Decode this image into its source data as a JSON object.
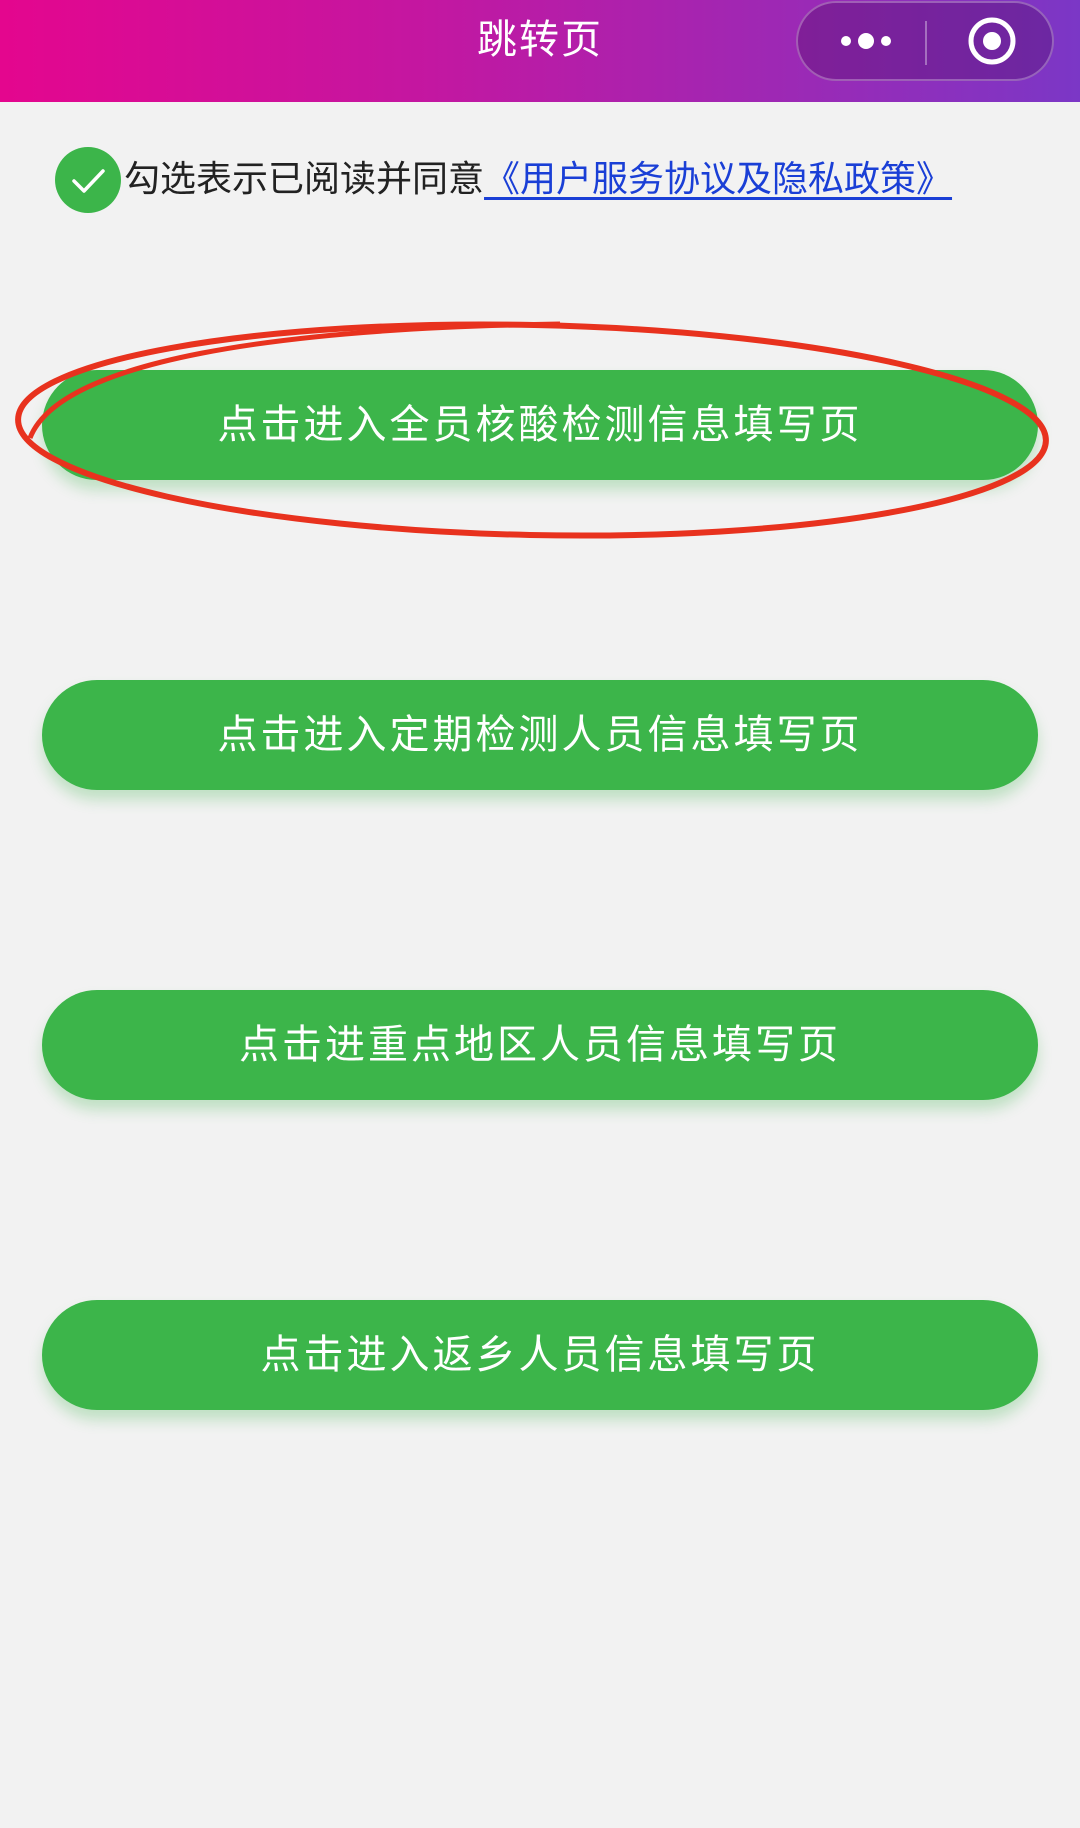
{
  "nav": {
    "title": "跳转页",
    "more_icon": "more-dots-icon",
    "close_icon": "target-close-icon"
  },
  "agreement": {
    "checked": true,
    "text": "勾选表示已阅读并同意",
    "link": "《用户服务协议及隐私政策》"
  },
  "buttons": [
    {
      "label": "点击进入全员核酸检测信息填写页"
    },
    {
      "label": "点击进入定期检测人员信息填写页"
    },
    {
      "label": "点击进重点地区人员信息填写页"
    },
    {
      "label": "点击进入返乡人员信息填写页"
    }
  ],
  "colors": {
    "button_green": "#3cb54a",
    "link_blue": "#1a3fd6",
    "highlight_red": "#e8321e",
    "nav_gradient_start": "#e4068e",
    "nav_gradient_end": "#7b37c6"
  }
}
